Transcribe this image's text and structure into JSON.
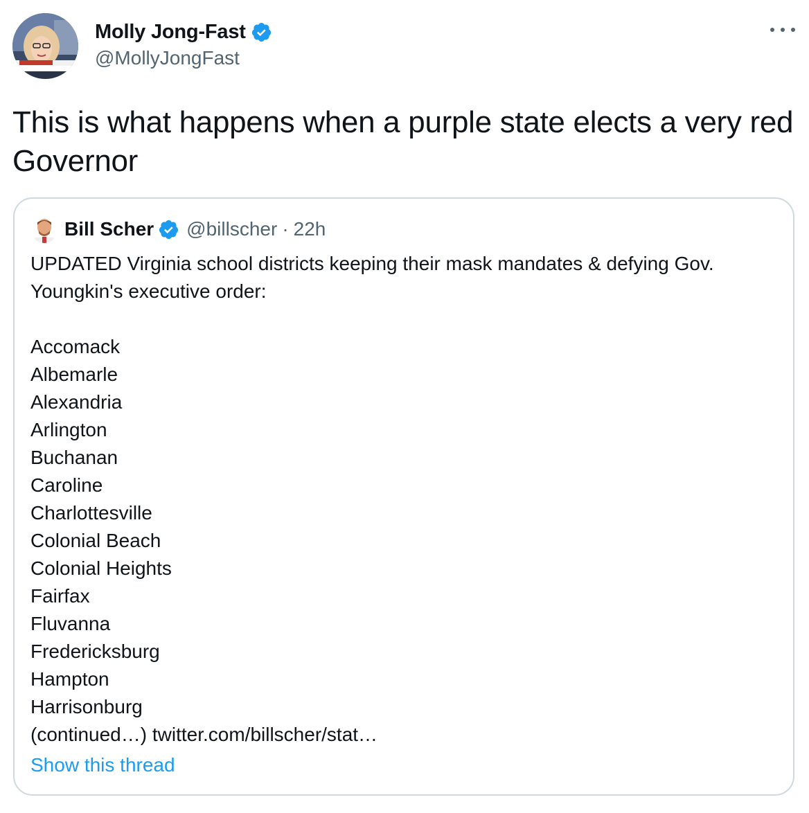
{
  "tweet": {
    "author": {
      "name": "Molly Jong-Fast",
      "handle": "@MollyJongFast",
      "verified": true,
      "avatar_icon": "profile-photo"
    },
    "more_icon": "ellipsis-icon",
    "text": "This is what happens when a purple state elects a very red Governor",
    "quoted": {
      "author": {
        "name": "Bill Scher",
        "handle": "@billscher",
        "verified": true,
        "avatar_icon": "profile-photo"
      },
      "separator": "·",
      "time": "22h",
      "intro": "UPDATED Virginia school districts keeping their mask mandates & defying Gov. Youngkin's executive order:",
      "districts": [
        "Accomack",
        "Albemarle",
        "Alexandria",
        "Arlington",
        "Buchanan",
        "Caroline",
        "Charlottesville",
        "Colonial Beach",
        "Colonial Heights",
        "Fairfax",
        "Fluvanna",
        "Fredericksburg",
        "Hampton",
        "Harrisonburg"
      ],
      "continued_text": "(continued…) twitter.com/billscher/stat…",
      "show_thread": "Show this thread"
    }
  },
  "colors": {
    "text_primary": "#0f1419",
    "text_secondary": "#536471",
    "link": "#1d9bf0",
    "verified": "#1d9bf0",
    "border": "#cfd9de"
  }
}
